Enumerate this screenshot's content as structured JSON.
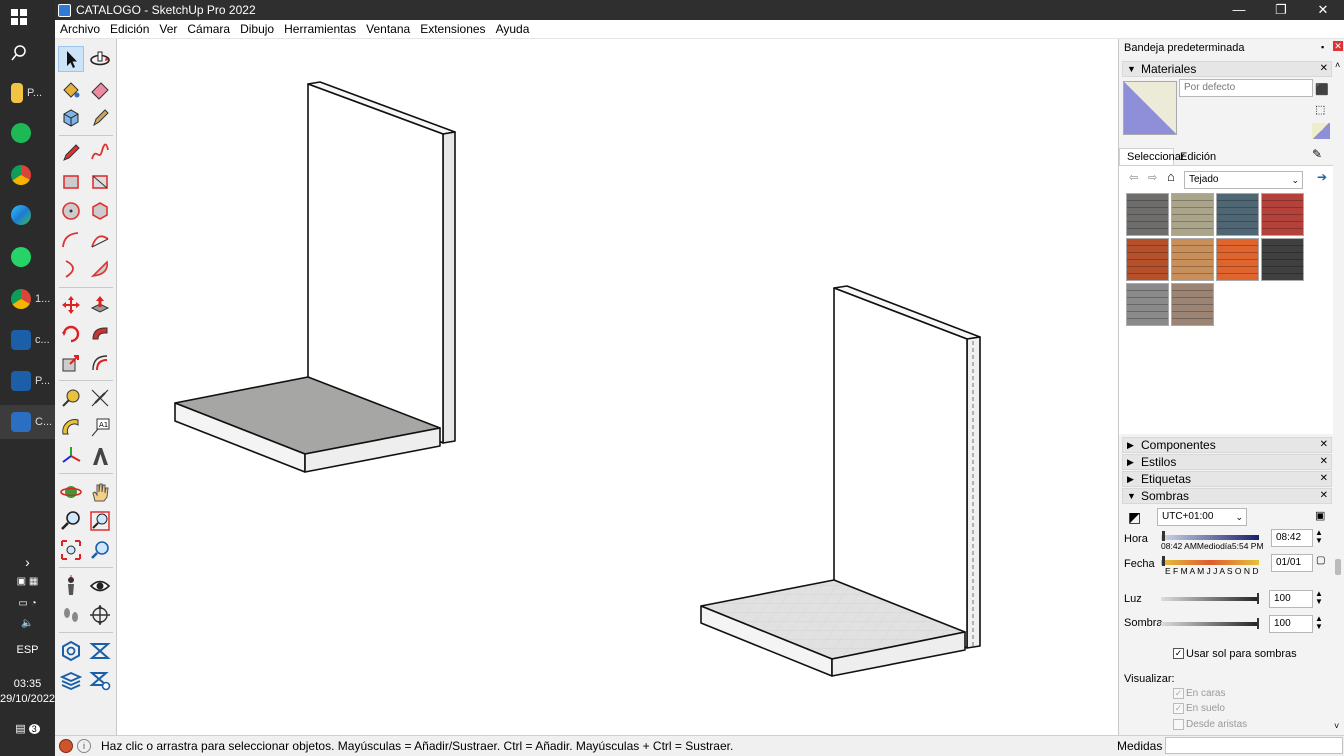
{
  "window": {
    "title": "CATALOGO - SketchUp Pro 2022",
    "minimize": "—",
    "maximize": "❐",
    "close": "✕"
  },
  "taskbar": {
    "items": [
      {
        "label": "P..."
      },
      {
        "label": "1..."
      },
      {
        "label": "c..."
      },
      {
        "label": "P..."
      },
      {
        "label": "C..."
      }
    ],
    "language": "ESP",
    "time": "03:35",
    "date": "29/10/2022",
    "notification_count": "3"
  },
  "menu": [
    "Archivo",
    "Edición",
    "Ver",
    "Cámara",
    "Dibujo",
    "Herramientas",
    "Ventana",
    "Extensiones",
    "Ayuda"
  ],
  "tray": {
    "title": "Bandeja predeterminada",
    "materials": {
      "header": "Materiales",
      "name_value": "Por defecto",
      "tab_select": "Seleccionar",
      "tab_edit": "Edición",
      "library": "Tejado",
      "swatch_colors": [
        "#6f6d6c",
        "#a9a48a",
        "#4f6775",
        "#b4423a",
        "#b5502b",
        "#c98f5a",
        "#e0642e",
        "#404040",
        "#8a8a8a",
        "#9b8473"
      ]
    },
    "panels": [
      "Componentes",
      "Estilos",
      "Etiquetas",
      "Sombras"
    ],
    "shadows": {
      "timezone": "UTC+01:00",
      "hora_label": "Hora",
      "hora_scale": "08:42 AMMediodía5:54 PM",
      "hora_value": "08:42",
      "fecha_label": "Fecha",
      "fecha_scale": "E F M A M J J A S O N D",
      "fecha_value": "01/01",
      "luz_label": "Luz",
      "luz_value": "100",
      "sombra_label": "Sombra",
      "sombra_value": "100",
      "use_sun": "Usar sol para sombras",
      "visualizar": "Visualizar:",
      "en_caras": "En caras",
      "en_suelo": "En suelo",
      "desde_aristas": "Desde aristas"
    }
  },
  "status": {
    "message": "Haz clic o arrastra para seleccionar objetos. Mayúsculas = Añadir/Sustraer. Ctrl = Añadir. Mayúsculas + Ctrl = Sustraer.",
    "measures_label": "Medidas"
  }
}
